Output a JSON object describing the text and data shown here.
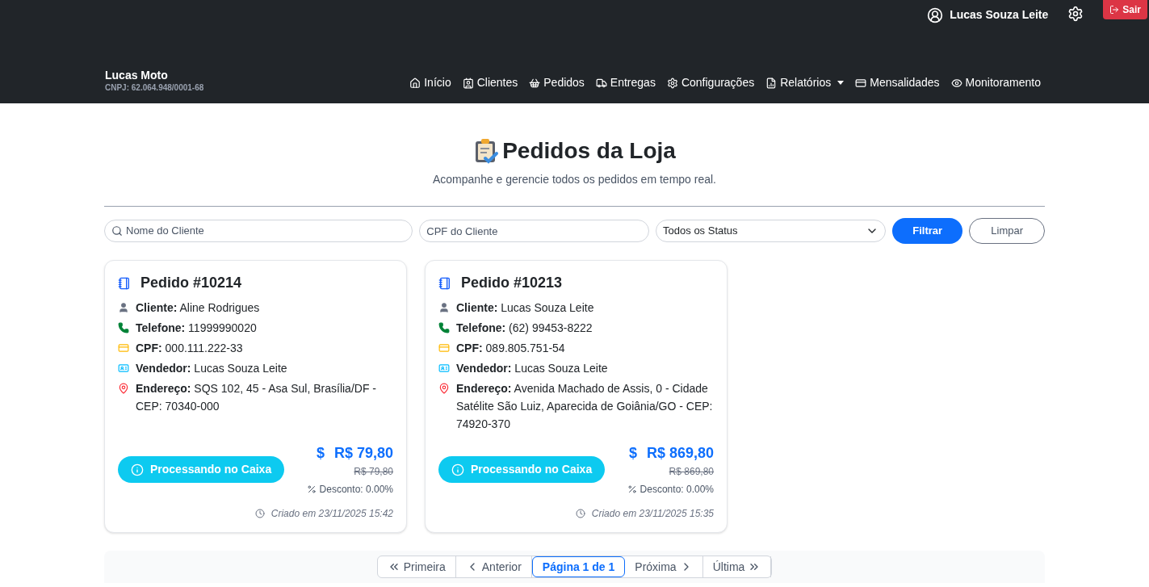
{
  "header": {
    "user": "Lucas Souza Leite",
    "logout": "Sair",
    "brand": "Lucas Moto",
    "cnpj": "CNPJ: 62.064.948/0001-68",
    "nav": [
      {
        "label": "Início",
        "dropdown": false
      },
      {
        "label": "Clientes",
        "dropdown": false
      },
      {
        "label": "Pedidos",
        "dropdown": false
      },
      {
        "label": "Entregas",
        "dropdown": false
      },
      {
        "label": "Configurações",
        "dropdown": false
      },
      {
        "label": "Relatórios",
        "dropdown": true
      },
      {
        "label": "Mensalidades",
        "dropdown": false
      },
      {
        "label": "Monitoramento",
        "dropdown": false
      }
    ]
  },
  "page": {
    "title": "Pedidos da Loja",
    "subtitle": "Acompanhe e gerencie todos os pedidos em tempo real."
  },
  "filters": {
    "name_placeholder": "Nome do Cliente",
    "cpf_placeholder": "CPF do Cliente",
    "status": "Todos os Status",
    "filter": "Filtrar",
    "clear": "Limpar"
  },
  "orders": [
    {
      "title": "Pedido #10214",
      "fields": [
        {
          "kind": "client",
          "label": "Cliente:",
          "value": "Aline Rodrigues"
        },
        {
          "kind": "phone",
          "label": "Telefone:",
          "value": "11999990020"
        },
        {
          "kind": "cpf",
          "label": "CPF:",
          "value": "000.111.222-33"
        },
        {
          "kind": "seller",
          "label": "Vendedor:",
          "value": "Lucas Souza Leite"
        },
        {
          "kind": "address",
          "label": "Endereço:",
          "value": "SQS 102, 45 - Asa Sul, Brasília/DF - CEP: 70340-000"
        }
      ],
      "status": "Processando no Caixa",
      "dollar": "$",
      "price": "R$ 79,80",
      "old_price": "R$ 79,80",
      "discount": "Desconto: 0.00%",
      "created": "Criado em 23/11/2025 15:42"
    },
    {
      "title": "Pedido #10213",
      "fields": [
        {
          "kind": "client",
          "label": "Cliente:",
          "value": "Lucas Souza Leite"
        },
        {
          "kind": "phone",
          "label": "Telefone:",
          "value": "(62) 99453-8222"
        },
        {
          "kind": "cpf",
          "label": "CPF:",
          "value": "089.805.751-54"
        },
        {
          "kind": "seller",
          "label": "Vendedor:",
          "value": "Lucas Souza Leite"
        },
        {
          "kind": "address",
          "label": "Endereço:",
          "value": "Avenida Machado de Assis, 0 - Cidade Satélite São Luiz, Aparecida de Goiânia/GO - CEP: 74920-370"
        }
      ],
      "status": "Processando no Caixa",
      "dollar": "$",
      "price": "R$ 869,80",
      "old_price": "R$ 869,80",
      "discount": "Desconto: 0.00%",
      "created": "Criado em 23/11/2025 15:35"
    }
  ],
  "pagination": [
    {
      "label": "Primeira",
      "kind": "first",
      "selected": false
    },
    {
      "label": "Anterior",
      "kind": "prev",
      "selected": false
    },
    {
      "label": "Página 1 de 1",
      "kind": "page",
      "selected": true
    },
    {
      "label": "Próxima",
      "kind": "next",
      "selected": false
    },
    {
      "label": "Última",
      "kind": "last",
      "selected": false
    }
  ]
}
